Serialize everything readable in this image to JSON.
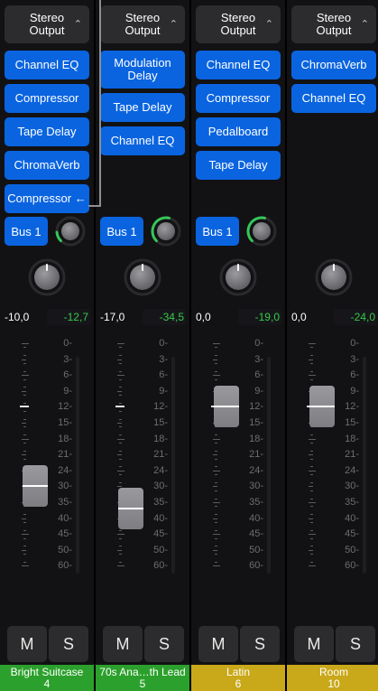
{
  "output_label": "Stereo Output",
  "colors": {
    "plugin_blue": "#0a64e0",
    "peak_green": "#36c84a",
    "send_arc_green": "#35c759",
    "name_green": "#2ca02c",
    "name_yellow": "#c9a81a"
  },
  "scale_labels": [
    "0",
    "3",
    "6",
    "9",
    "12",
    "15",
    "18",
    "21",
    "24",
    "30",
    "35",
    "40",
    "45",
    "50",
    "60"
  ],
  "strips": [
    {
      "plugins": [
        "Channel EQ",
        "Compressor",
        "Tape Delay",
        "ChromaVerb",
        "Compressor ←"
      ],
      "bus_label": "Bus 1",
      "send_level": 0.15,
      "volume": "-10,0",
      "peak": "-12,7",
      "fader_db": -30,
      "mute_label": "M",
      "solo_label": "S",
      "name": "Bright Suitcase",
      "number": "4",
      "name_color": "green"
    },
    {
      "plugins": [
        "Modulation Delay",
        "Tape Delay",
        "Channel EQ"
      ],
      "bus_label": "Bus 1",
      "send_level": 0.55,
      "volume": "-17,0",
      "peak": "-34,5",
      "fader_db": -37,
      "mute_label": "M",
      "solo_label": "S",
      "name": "70s Ana…th Lead",
      "number": "5",
      "name_color": "green"
    },
    {
      "plugins": [
        "Channel EQ",
        "Compressor",
        "Pedalboard",
        "Tape Delay"
      ],
      "bus_label": "Bus 1",
      "send_level": 0.55,
      "volume": "0,0",
      "peak": "-19,0",
      "fader_db": 0,
      "mute_label": "M",
      "solo_label": "S",
      "name": "Latin",
      "number": "6",
      "name_color": "yellow"
    },
    {
      "plugins": [
        "ChromaVerb",
        "Channel EQ"
      ],
      "bus_label": "",
      "send_level": 0,
      "volume": "0,0",
      "peak": "-24,0",
      "fader_db": 0,
      "mute_label": "M",
      "solo_label": "S",
      "name": "Room",
      "number": "10",
      "name_color": "yellow"
    }
  ]
}
